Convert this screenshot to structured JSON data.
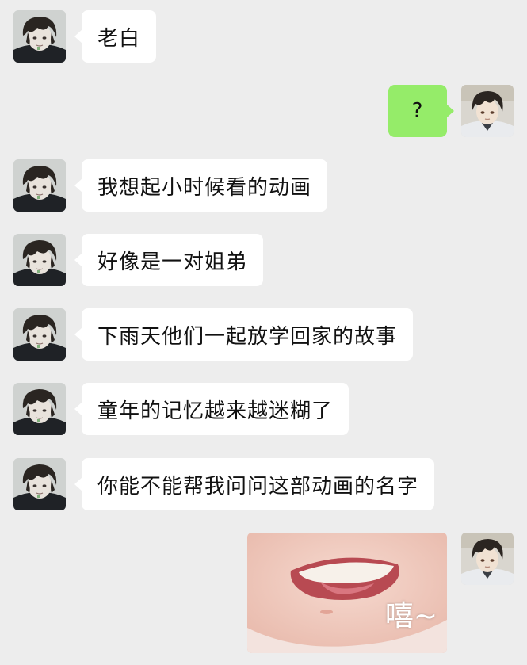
{
  "messages": [
    {
      "side": "left",
      "text": "老白"
    },
    {
      "side": "right",
      "text": "?"
    },
    {
      "side": "left",
      "text": "我想起小时候看的动画"
    },
    {
      "side": "left",
      "text": "好像是一对姐弟"
    },
    {
      "side": "left",
      "text": "下雨天他们一起放学回家的故事"
    },
    {
      "side": "left",
      "text": "童年的记忆越来越迷糊了"
    },
    {
      "side": "left",
      "text": "你能不能帮我问问这部动画的名字"
    }
  ],
  "sticker": {
    "caption": "嘻~"
  },
  "colors": {
    "background": "#ededed",
    "incoming": "#ffffff",
    "outgoing": "#95ec69"
  }
}
